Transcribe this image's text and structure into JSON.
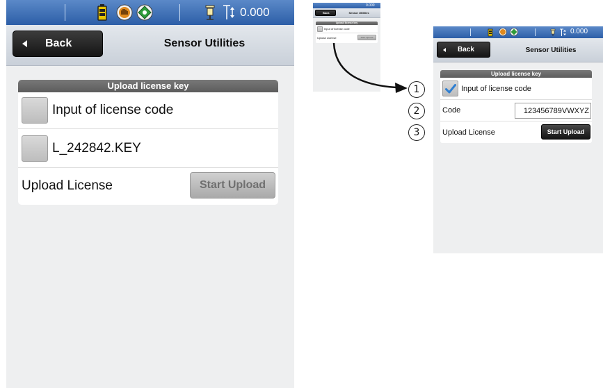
{
  "status": {
    "value": "0.000"
  },
  "header": {
    "back_label": "Back",
    "title": "Sensor Utilities"
  },
  "left_screen": {
    "panel_title": "Upload license key",
    "rows": [
      {
        "label": "Input of license code",
        "checked": false
      },
      {
        "label": "L_242842.KEY",
        "checked": false
      }
    ],
    "upload_label": "Upload License",
    "upload_button": "Start Upload"
  },
  "thumbnail": {
    "panel_title": "Upload license key",
    "row_label": "Input of license code",
    "upload_label": "Upload License",
    "upload_button": "Start Upload"
  },
  "right_screen": {
    "panel_title": "Upload license key",
    "checkbox_label": "Input of license code",
    "checked": true,
    "code_label": "Code",
    "code_value": "123456789VWXYZ",
    "upload_label": "Upload License",
    "upload_button": "Start Upload"
  },
  "callouts": [
    "1",
    "2",
    "3"
  ],
  "colors": {
    "statusbar": "#2c5ea7",
    "checkmark": "#2f7fd1",
    "panel_header": "#666666"
  }
}
